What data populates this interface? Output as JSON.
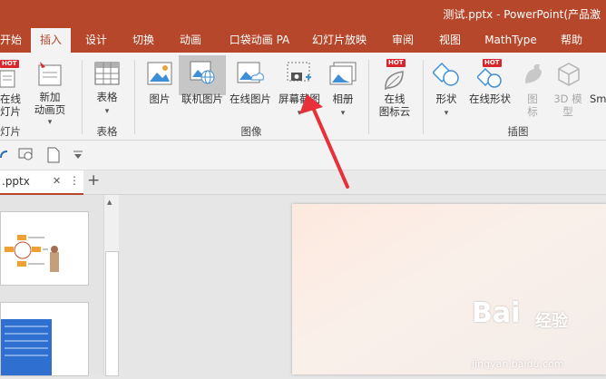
{
  "window": {
    "title": "测试.pptx - PowerPoint(产品激"
  },
  "tabs": [
    {
      "label": "开始"
    },
    {
      "label": "插入",
      "active": true
    },
    {
      "label": "设计"
    },
    {
      "label": "切换"
    },
    {
      "label": "动画"
    },
    {
      "label": "口袋动画 PA"
    },
    {
      "label": "幻灯片放映"
    },
    {
      "label": "审阅"
    },
    {
      "label": "视图"
    },
    {
      "label": "MathType"
    },
    {
      "label": "帮助"
    }
  ],
  "ribbon": {
    "slides": {
      "online_slides": "在线\n灯片",
      "new_anim_page": "新加\n动画页",
      "new_caret": "▾",
      "group": "灯片",
      "hot": "HOT"
    },
    "table": {
      "label": "表格",
      "group": "表格"
    },
    "images": {
      "picture": "图片",
      "online_pic": "联机图片",
      "online_pic2": "在线图片",
      "screenshot": "屏幕截图",
      "album": "相册",
      "group": "图像"
    },
    "iconcloud": {
      "label": "在线\n图标云",
      "hot": "HOT"
    },
    "illustrations": {
      "shapes": "形状",
      "online_shapes": "在线形状",
      "icons": "图\n标",
      "model3d": "3D 模\n型",
      "smartart": "Sm",
      "group": "插图",
      "hot": "HOT"
    }
  },
  "doc": {
    "tab_label": ".pptx",
    "close": "✕",
    "more": "⋮",
    "add": "+"
  },
  "watermark": {
    "brand": "Bai",
    "brand2": "经验",
    "url": "jingyan.baidu.com"
  },
  "colors": {
    "accent": "#b7472a",
    "arrow": "#e8303a"
  }
}
